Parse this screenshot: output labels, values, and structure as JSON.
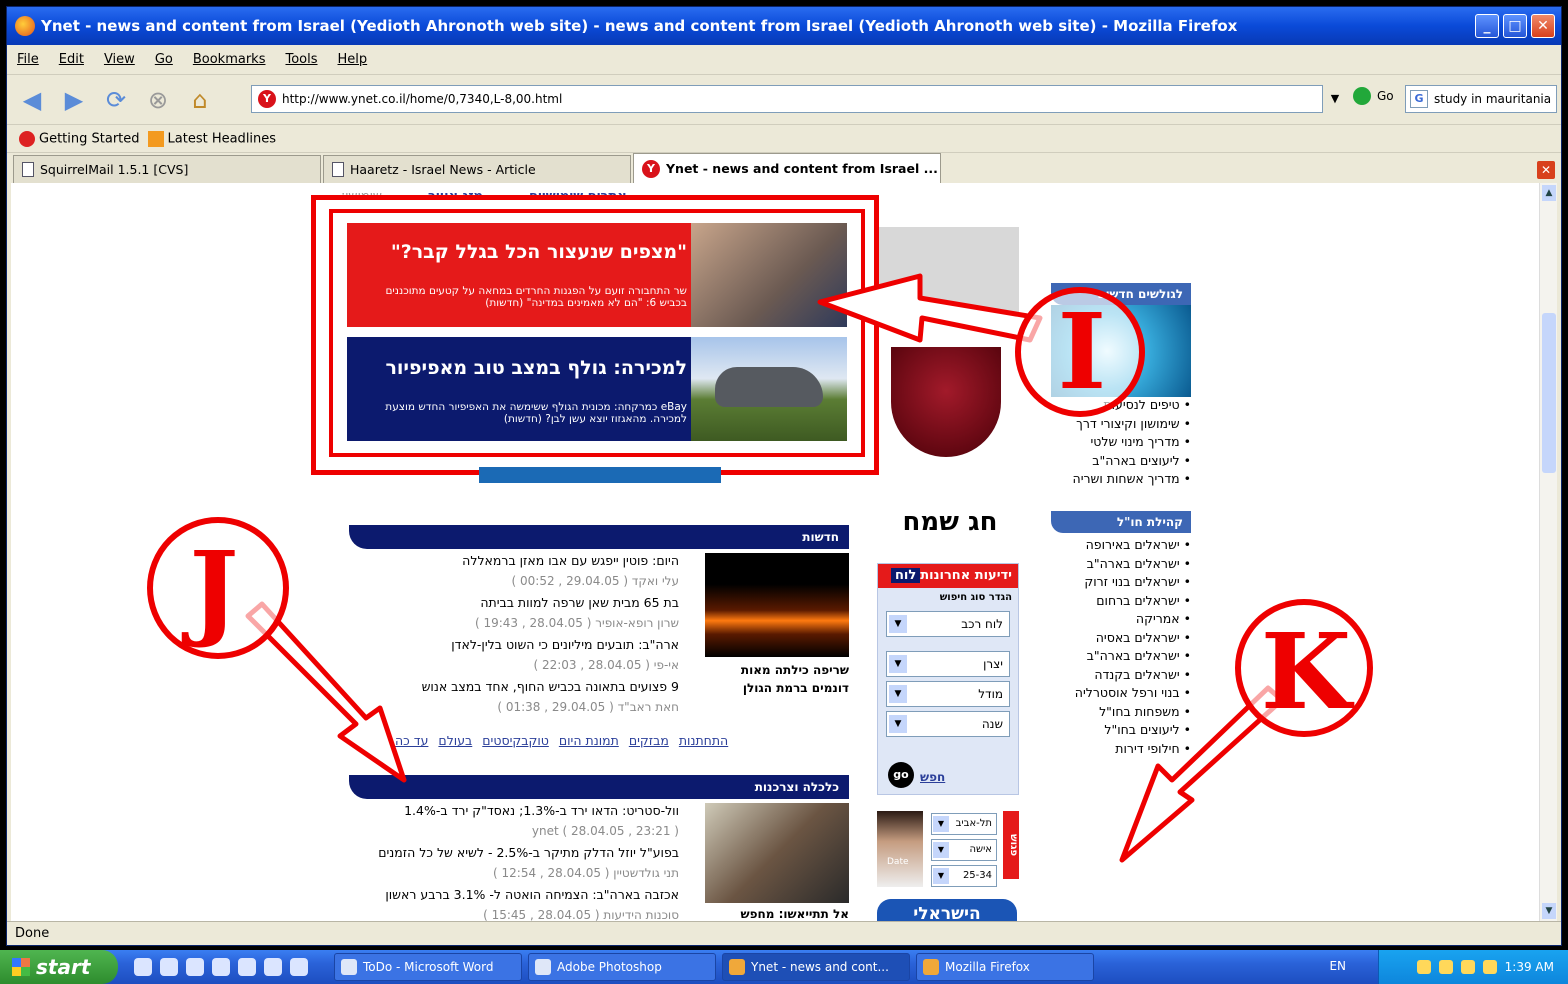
{
  "window": {
    "title": "Ynet - news and content from Israel (Yedioth Ahronoth web site) - news and content from Israel (Yedioth Ahronoth web site) - Mozilla Firefox"
  },
  "menu": [
    "File",
    "Edit",
    "View",
    "Go",
    "Bookmarks",
    "Tools",
    "Help"
  ],
  "nav": {
    "url": "http://www.ynet.co.il/home/0,7340,L-8,00.html",
    "go_label": "Go",
    "search_value": "study in mauritania"
  },
  "bookmarks": [
    "Getting Started",
    "Latest Headlines"
  ],
  "tabs": [
    {
      "label": "SquirrelMail 1.5.1 [CVS]"
    },
    {
      "label": "Haaretz - Israel News - Article"
    },
    {
      "label": "Ynet - news and content from Israel ..."
    }
  ],
  "page": {
    "topnav": [
      "שימושי:",
      "מזג אוויר",
      "אתרים שימושיים"
    ],
    "ad1": {
      "headline": "\"מצפים שנעצור הכל בגלל קבר?\"",
      "sub": "שר התחבורה זועם על הפגנות החרדים במחאה על קטעים מתוכננים בכביש 6: \"הם לא מאמינים במדינה\" (חדשות)"
    },
    "ad2": {
      "headline": "למכירה: גולף במצב טוב מאפיפיור",
      "sub": "eBay כמרקחה: מכונית הגולף ששימשה את האפיפיור החדש מוצעת למכירה. מהאגזוז יוצא עשן לבן? (חדשות)"
    },
    "news_header": "חדשות",
    "news": [
      {
        "title": "היום: פוטין ייפגש עם אבו מאזן ברמאללה",
        "meta": "עלי ואקד ( 29.04.05 , 00:52 )"
      },
      {
        "title": "בת 65 מבית שאן שרפה למוות בביתה",
        "meta": "שרון רופא-אופיר ( 28.04.05 , 19:43 )"
      },
      {
        "title": "ארה\"ב: תובעים מיליונים כי השוט בלין-לאדן",
        "meta": "אי-פי ( 28.04.05 , 22:03 )"
      },
      {
        "title": "9 פצועים בתאונה בכביש החוף, אחד במצב אנוש",
        "meta": "חאת ראב\"ד ( 29.04.05 , 01:38 )"
      }
    ],
    "fire_caption": "שריפה כילתה מאות דונמים ברמת הגולן",
    "news_links": [
      "התחתנות",
      "מבזקים",
      "תמונת היום",
      "טוקבקיסטים",
      "בעולם",
      "עד כה"
    ],
    "econ_header": "כלכלה וצרכנות",
    "econ": [
      {
        "title": "וול-סטריט: הדאו ירד ב-1.3%; נאסד\"ק ירד ב-1.4%",
        "meta": "ynet ( 28.04.05 , 23:21 )"
      },
      {
        "title": "בפוע\"ל יוזל הדלק מתיקר ב-2.5% - לשיא של כל הזמנים",
        "meta": "תני גולדשטיין ( 28.04.05 , 12:54 )"
      },
      {
        "title": "אכזבה בארה\"ב: הצמיחה הואטה ל- 3.1% ברבע ראשון",
        "meta": "סוכנות הידיעות ( 28.04.05 , 15:45 )"
      }
    ],
    "econ_caption": "אל תתייאשו: מחפש",
    "holiday_title": "חג שמח",
    "search_panel": {
      "header": "ידיעות אחרונות",
      "header_tag": "לוח",
      "subtitle": "הגדר סוג חיפוש",
      "fields": [
        "לוח רכב",
        "יצרן",
        "מודל",
        "שנה"
      ],
      "go": "go",
      "go_text": "חפש"
    },
    "dating": {
      "tab": "פגוש",
      "fields": [
        "תל-אביב",
        "אישה",
        "25-34"
      ],
      "face_label": "Date"
    },
    "israeli": "הישראלי",
    "side1": {
      "header": "לגולשים חדשים",
      "items": [
        "טיפים לנסיעות",
        "שימושון וקיצורי דרך",
        "מדריך מינוי שלטי",
        "ליעוצים בארה\"ב",
        "מדריך אשחות ושריה"
      ]
    },
    "side2": {
      "header": "קהילת חו\"ל",
      "items": [
        "ישראלים באירופה",
        "ישראלים בארה\"ב",
        "ישראלים בנוי זרוק",
        "ישראלים ברחום",
        "אמריקה",
        "ישראלים באסיה",
        "ישראלים בארה\"ב",
        "ישראלים בקנדה",
        "בנוי ורפל אוסטרליה",
        "משפחות בחו\"ל",
        "ליעוצים בחו\"ל",
        "חילופי דירות"
      ]
    }
  },
  "annotations": {
    "I": "I",
    "J": "J",
    "K": "K"
  },
  "status": "Done",
  "taskbar": {
    "start": "start",
    "tasks": [
      "ToDo - Microsoft Word",
      "Adobe Photoshop",
      "Ynet - news and cont...",
      "Mozilla Firefox"
    ],
    "lang": "EN",
    "clock": "1:39 AM"
  }
}
